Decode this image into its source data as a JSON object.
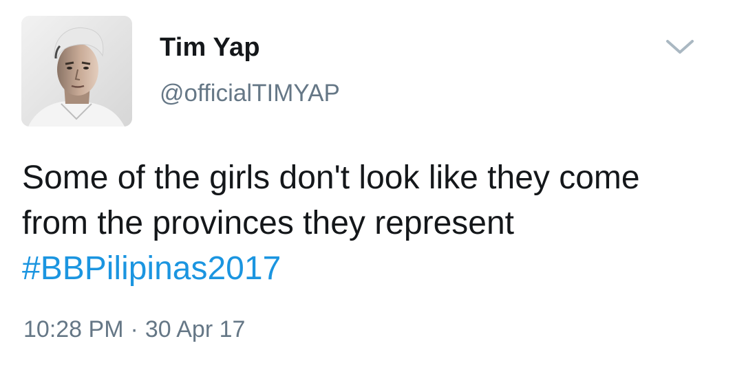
{
  "tweet": {
    "author": {
      "name": "Tim Yap",
      "handle": "@officialTIMYAP"
    },
    "text_line1": "Some of the girls don't look like they come",
    "text_line2": "from the provinces they represent",
    "hashtag": "#BBPilipinas2017",
    "time": "10:28 PM",
    "separator": "·",
    "date": "30 Apr 17"
  },
  "colors": {
    "text": "#14171a",
    "secondary": "#657786",
    "link": "#1b95e0"
  },
  "icons": {
    "menu": "chevron-down-icon"
  }
}
